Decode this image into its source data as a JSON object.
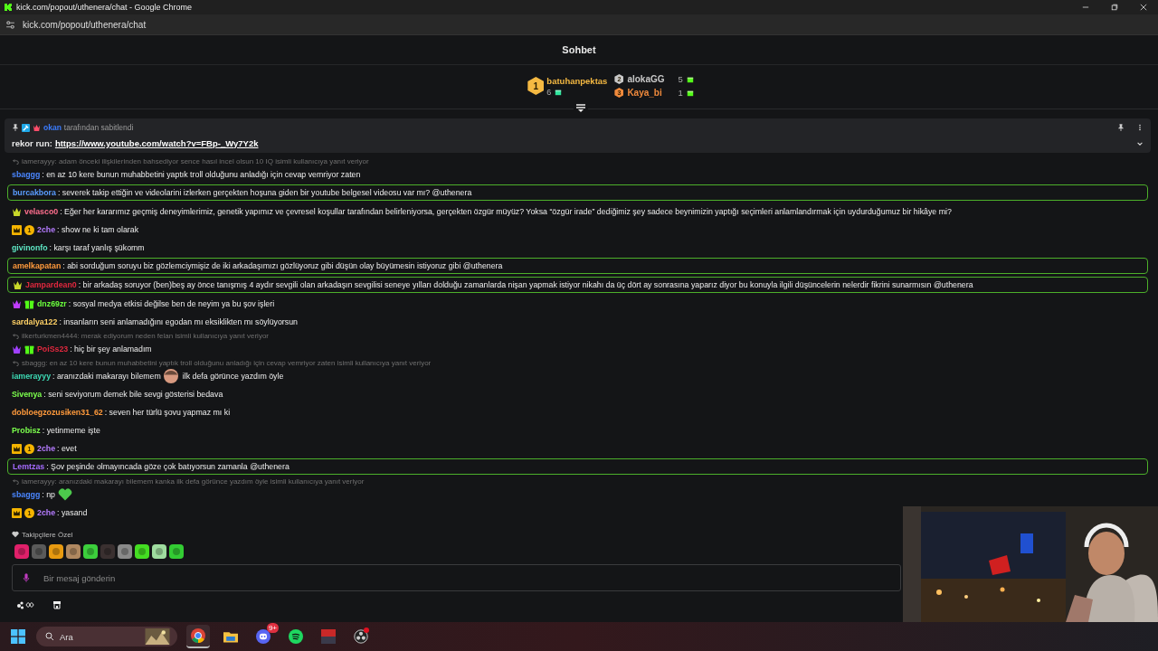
{
  "browser": {
    "title": "kick.com/popout/uthenera/chat - Google Chrome",
    "url": "kick.com/popout/uthenera/chat"
  },
  "chat_header": {
    "title": "Sohbet"
  },
  "gift_leaderboard": [
    {
      "rank": "1",
      "name": "batuhanpektas",
      "count": "6",
      "color": "#f5b942"
    },
    {
      "rank": "2",
      "name": "alokaGG",
      "count": "5",
      "color": "#c8c8c8"
    },
    {
      "rank": "3",
      "name": "Kaya_bi",
      "count": "1",
      "color": "#f08a3c"
    }
  ],
  "pinned": {
    "user": "okan",
    "note": "tarafından sabitlendi",
    "label": "rekor run:",
    "link": "https://www.youtube.com/watch?v=FBp-_Wy7Y2k"
  },
  "messages": [
    {
      "kind": "reply",
      "text": "iamerayyy: adam önceki ilişkilerinden bahsediyor sence hasıl incel olsun 10 IQ isimli kullanıcıya yanıt veriyor"
    },
    {
      "kind": "message",
      "user": "sbaggg",
      "color": "#4a86ff",
      "text": ": en az 10 kere bunun muhabbetini yaptık troll olduğunu anladığı için cevap vemriyor zaten",
      "highlighted": false
    },
    {
      "kind": "message",
      "user": "burcakbora",
      "color": "#5a9cff",
      "text": ": severek takip ettiğin ve videolarini izlerken gerçekten hoşuna giden bir youtube belgesel videosu var mı? @uthenera",
      "highlighted": true
    },
    {
      "kind": "message",
      "user": "velasco0",
      "color": "#ff6f8e",
      "badges": [
        {
          "kind": "sub",
          "color": "#c8d82a"
        }
      ],
      "text": ": Eğer her kararımız geçmiş deneyimlerimiz, genetik yapımız ve çevresel koşullar tarafından belirleniyorsa, gerçekten özgür müyüz? Yoksa “özgür irade” dediğimiz şey sadece beynimizin yaptığı seçimleri anlamlandırmak için uydurduğumuz bir hikâye mi?",
      "highlighted": false
    },
    {
      "kind": "message",
      "user": "2che",
      "color": "#b57bff",
      "badges": [
        {
          "kind": "crown",
          "color": "#f5b400"
        },
        {
          "kind": "gifter",
          "color": "#f5b400",
          "label": "1"
        }
      ],
      "text": ": show ne ki tam olarak",
      "highlighted": false
    },
    {
      "kind": "message",
      "user": "givinonfo",
      "color": "#5ee6c4",
      "text": ": karşı taraf yanlış şükomm",
      "highlighted": false
    },
    {
      "kind": "message",
      "user": "amelkapatan",
      "color": "#ff9a3c",
      "text": ": abi sorduğum soruyu biz gözlemciymişiz de iki arkadaşımızı gözlüyoruz gibi düşün olay büyümesin istiyoruz gibi @uthenera",
      "highlighted": true
    },
    {
      "kind": "message",
      "user": "Jampardean0",
      "color": "#e0283e",
      "badges": [
        {
          "kind": "sub",
          "color": "#c8d82a"
        }
      ],
      "text": ": bir arkadaş soruyor (ben)beş ay önce tanışmış 4 aydır sevgili olan arkadaşın sevgilisi seneye yılları dolduğu zamanlarda nişan yapmak istiyor nikahı da üç dört ay sonrasına yaparız diyor bu konuyla ilgili düşüncelerin nelerdir fikrini sunarmısın @uthenera",
      "highlighted": true
    },
    {
      "kind": "message",
      "user": "dnz69zr",
      "color": "#6bff3d",
      "badges": [
        {
          "kind": "sub",
          "color": "#c03cff"
        },
        {
          "kind": "gift",
          "color": "#53fc18"
        }
      ],
      "text": ": sosyal medya etkisi değilse ben de neyim ya bu şov işleri",
      "highlighted": false
    },
    {
      "kind": "message",
      "user": "sardalya122",
      "color": "#ffd166",
      "text": ": insanların seni anlamadığını egodan mı eksiklikten mı söylüyorsun",
      "highlighted": false
    },
    {
      "kind": "reply",
      "text": "ilkerturkmen4444: merak ediyorum neden felan isimli kullanıcıya yanıt veriyor"
    },
    {
      "kind": "message",
      "user": "PoiSs23",
      "color": "#e0283e",
      "badges": [
        {
          "kind": "sub",
          "color": "#a040ff"
        },
        {
          "kind": "gift",
          "color": "#53fc18"
        }
      ],
      "text": ": hiç bir şey anlamadım",
      "highlighted": false
    },
    {
      "kind": "reply",
      "text": "sbaggg: en az 10 kere bunun muhabbetini yaptık troll olduğunu anladığı için cevap vemriyor zaten isimli kullanıcıya yanıt veriyor"
    },
    {
      "kind": "message",
      "user": "iamerayyy",
      "color": "#3ddbb5",
      "text": ": aranızdaki makarayı bilemem",
      "emote": {
        "kind": "round"
      },
      "text_after": "ilk defa görünce yazdım öyle",
      "highlighted": false
    },
    {
      "kind": "message",
      "user": "Sivenya",
      "color": "#7cff4d",
      "text": ": seni seviyorum demek bile sevgi gösterisi bedava",
      "highlighted": false
    },
    {
      "kind": "message",
      "user": "dobloegzozusiken31_62",
      "color": "#ff9a3c",
      "text": ": seven her türlü şovu yapmaz mı ki",
      "highlighted": false
    },
    {
      "kind": "message",
      "user": "Probisz",
      "color": "#7cff4d",
      "text": ": yetinmeme işte",
      "highlighted": false
    },
    {
      "kind": "message",
      "user": "2che",
      "color": "#b57bff",
      "badges": [
        {
          "kind": "crown",
          "color": "#f5b400"
        },
        {
          "kind": "gifter",
          "color": "#f5b400",
          "label": "1"
        }
      ],
      "text": ": evet",
      "highlighted": false
    },
    {
      "kind": "message",
      "user": "Lemtzas",
      "color": "#a56bff",
      "text": ": Şov peşinde olmayıncada göze çok batıyorsun zamanla @uthenera",
      "highlighted": true
    },
    {
      "kind": "reply",
      "text": "iamerayyy: aranızdaki makarayı bilemem kanka ilk defa görünce yazdım öyle isimli kullanıcıya yanıt veriyor"
    },
    {
      "kind": "message",
      "user": "sbaggg",
      "color": "#4a86ff",
      "text": ": np",
      "emote": {
        "kind": "heart"
      },
      "highlighted": false
    },
    {
      "kind": "message",
      "user": "2che",
      "color": "#b57bff",
      "badges": [
        {
          "kind": "crown",
          "color": "#f5b400"
        },
        {
          "kind": "gifter",
          "color": "#f5b400",
          "label": "1"
        }
      ],
      "text": ": yasand",
      "highlighted": false
    }
  ],
  "followers_only": {
    "label": "Takipçilere Özel",
    "emotes": [
      {
        "color": "#e0206a"
      },
      {
        "color": "#5a5a5a"
      },
      {
        "color": "#e89a10"
      },
      {
        "color": "#b08860"
      },
      {
        "color": "#3ccf3c"
      },
      {
        "color": "#3a3030"
      },
      {
        "color": "#8a8a8a"
      },
      {
        "color": "#44dd22"
      },
      {
        "color": "#9fdc9f"
      },
      {
        "color": "#33cc33"
      }
    ]
  },
  "composer": {
    "placeholder": "Bir mesaj gönderin"
  },
  "taskbar": {
    "search_placeholder": "Ara",
    "apps": [
      {
        "kind": "chrome",
        "active": true
      },
      {
        "kind": "folder",
        "active": false
      },
      {
        "kind": "discord",
        "active": false,
        "badge": "9+"
      },
      {
        "kind": "spotify",
        "active": false
      },
      {
        "kind": "mixer",
        "active": false
      },
      {
        "kind": "obs",
        "active": false
      }
    ]
  }
}
